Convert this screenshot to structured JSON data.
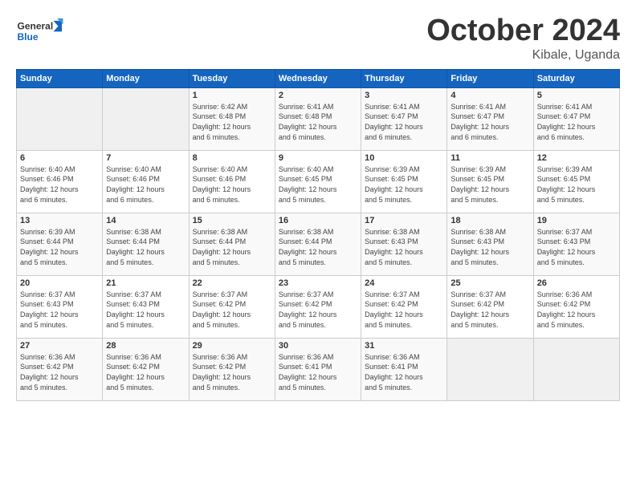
{
  "header": {
    "logo_general": "General",
    "logo_blue": "Blue",
    "month_title": "October 2024",
    "location": "Kibale, Uganda"
  },
  "weekdays": [
    "Sunday",
    "Monday",
    "Tuesday",
    "Wednesday",
    "Thursday",
    "Friday",
    "Saturday"
  ],
  "weeks": [
    [
      {
        "day": "",
        "info": ""
      },
      {
        "day": "",
        "info": ""
      },
      {
        "day": "1",
        "info": "Sunrise: 6:42 AM\nSunset: 6:48 PM\nDaylight: 12 hours\nand 6 minutes."
      },
      {
        "day": "2",
        "info": "Sunrise: 6:41 AM\nSunset: 6:48 PM\nDaylight: 12 hours\nand 6 minutes."
      },
      {
        "day": "3",
        "info": "Sunrise: 6:41 AM\nSunset: 6:47 PM\nDaylight: 12 hours\nand 6 minutes."
      },
      {
        "day": "4",
        "info": "Sunrise: 6:41 AM\nSunset: 6:47 PM\nDaylight: 12 hours\nand 6 minutes."
      },
      {
        "day": "5",
        "info": "Sunrise: 6:41 AM\nSunset: 6:47 PM\nDaylight: 12 hours\nand 6 minutes."
      }
    ],
    [
      {
        "day": "6",
        "info": "Sunrise: 6:40 AM\nSunset: 6:46 PM\nDaylight: 12 hours\nand 6 minutes."
      },
      {
        "day": "7",
        "info": "Sunrise: 6:40 AM\nSunset: 6:46 PM\nDaylight: 12 hours\nand 6 minutes."
      },
      {
        "day": "8",
        "info": "Sunrise: 6:40 AM\nSunset: 6:46 PM\nDaylight: 12 hours\nand 6 minutes."
      },
      {
        "day": "9",
        "info": "Sunrise: 6:40 AM\nSunset: 6:45 PM\nDaylight: 12 hours\nand 5 minutes."
      },
      {
        "day": "10",
        "info": "Sunrise: 6:39 AM\nSunset: 6:45 PM\nDaylight: 12 hours\nand 5 minutes."
      },
      {
        "day": "11",
        "info": "Sunrise: 6:39 AM\nSunset: 6:45 PM\nDaylight: 12 hours\nand 5 minutes."
      },
      {
        "day": "12",
        "info": "Sunrise: 6:39 AM\nSunset: 6:45 PM\nDaylight: 12 hours\nand 5 minutes."
      }
    ],
    [
      {
        "day": "13",
        "info": "Sunrise: 6:39 AM\nSunset: 6:44 PM\nDaylight: 12 hours\nand 5 minutes."
      },
      {
        "day": "14",
        "info": "Sunrise: 6:38 AM\nSunset: 6:44 PM\nDaylight: 12 hours\nand 5 minutes."
      },
      {
        "day": "15",
        "info": "Sunrise: 6:38 AM\nSunset: 6:44 PM\nDaylight: 12 hours\nand 5 minutes."
      },
      {
        "day": "16",
        "info": "Sunrise: 6:38 AM\nSunset: 6:44 PM\nDaylight: 12 hours\nand 5 minutes."
      },
      {
        "day": "17",
        "info": "Sunrise: 6:38 AM\nSunset: 6:43 PM\nDaylight: 12 hours\nand 5 minutes."
      },
      {
        "day": "18",
        "info": "Sunrise: 6:38 AM\nSunset: 6:43 PM\nDaylight: 12 hours\nand 5 minutes."
      },
      {
        "day": "19",
        "info": "Sunrise: 6:37 AM\nSunset: 6:43 PM\nDaylight: 12 hours\nand 5 minutes."
      }
    ],
    [
      {
        "day": "20",
        "info": "Sunrise: 6:37 AM\nSunset: 6:43 PM\nDaylight: 12 hours\nand 5 minutes."
      },
      {
        "day": "21",
        "info": "Sunrise: 6:37 AM\nSunset: 6:43 PM\nDaylight: 12 hours\nand 5 minutes."
      },
      {
        "day": "22",
        "info": "Sunrise: 6:37 AM\nSunset: 6:42 PM\nDaylight: 12 hours\nand 5 minutes."
      },
      {
        "day": "23",
        "info": "Sunrise: 6:37 AM\nSunset: 6:42 PM\nDaylight: 12 hours\nand 5 minutes."
      },
      {
        "day": "24",
        "info": "Sunrise: 6:37 AM\nSunset: 6:42 PM\nDaylight: 12 hours\nand 5 minutes."
      },
      {
        "day": "25",
        "info": "Sunrise: 6:37 AM\nSunset: 6:42 PM\nDaylight: 12 hours\nand 5 minutes."
      },
      {
        "day": "26",
        "info": "Sunrise: 6:36 AM\nSunset: 6:42 PM\nDaylight: 12 hours\nand 5 minutes."
      }
    ],
    [
      {
        "day": "27",
        "info": "Sunrise: 6:36 AM\nSunset: 6:42 PM\nDaylight: 12 hours\nand 5 minutes."
      },
      {
        "day": "28",
        "info": "Sunrise: 6:36 AM\nSunset: 6:42 PM\nDaylight: 12 hours\nand 5 minutes."
      },
      {
        "day": "29",
        "info": "Sunrise: 6:36 AM\nSunset: 6:42 PM\nDaylight: 12 hours\nand 5 minutes."
      },
      {
        "day": "30",
        "info": "Sunrise: 6:36 AM\nSunset: 6:41 PM\nDaylight: 12 hours\nand 5 minutes."
      },
      {
        "day": "31",
        "info": "Sunrise: 6:36 AM\nSunset: 6:41 PM\nDaylight: 12 hours\nand 5 minutes."
      },
      {
        "day": "",
        "info": ""
      },
      {
        "day": "",
        "info": ""
      }
    ]
  ]
}
